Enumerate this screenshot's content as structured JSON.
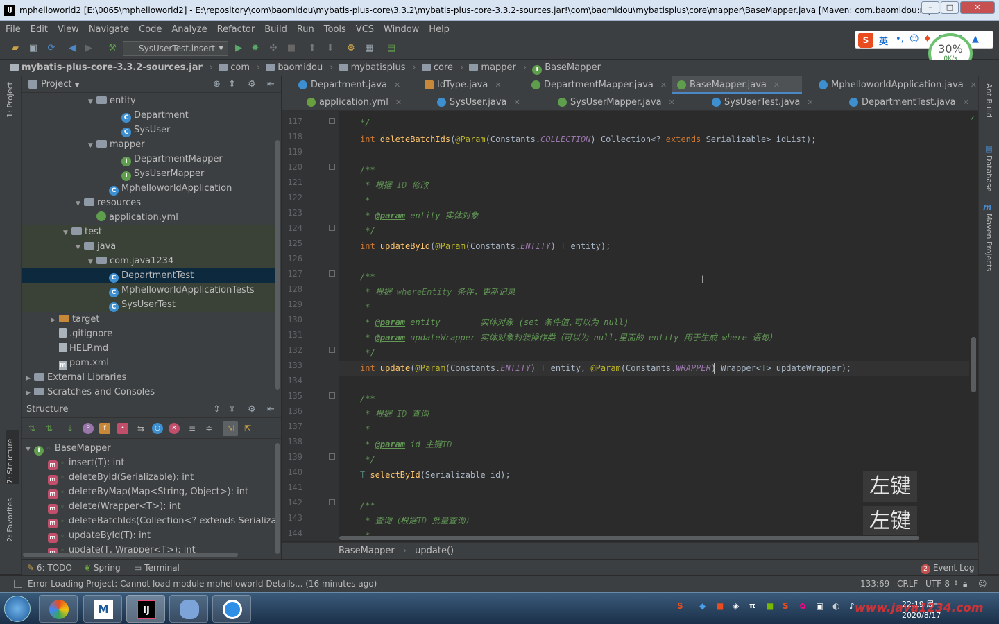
{
  "window": {
    "title": "mphelloworld2 [E:\\0065\\mphelloworld2] - E:\\repository\\com\\baomidou\\mybatis-plus-core\\3.3.2\\mybatis-plus-core-3.3.2-sources.jar!\\com\\baomidou\\mybatisplus\\core\\mapper\\BaseMapper.java [Maven: com.baomidou:myb..."
  },
  "menu": [
    "File",
    "Edit",
    "View",
    "Navigate",
    "Code",
    "Analyze",
    "Refactor",
    "Build",
    "Run",
    "Tools",
    "VCS",
    "Window",
    "Help"
  ],
  "toolbar": {
    "run_config": "SysUserTest.insert"
  },
  "breadcrumb": [
    "mybatis-plus-core-3.3.2-sources.jar",
    "com",
    "baomidou",
    "mybatisplus",
    "core",
    "mapper",
    "BaseMapper"
  ],
  "network": {
    "percent": "30%",
    "speed": "0K/s"
  },
  "ime": {
    "lang": "英"
  },
  "left_strip": {
    "project": "1: Project",
    "structure": "7: Structure",
    "favorites": "2: Favorites"
  },
  "right_strip": {
    "ant": "Ant Build",
    "database": "Database",
    "maven": "Maven Projects"
  },
  "project_panel": {
    "title": "Project",
    "rows": [
      {
        "label": "entity",
        "icon": "folder"
      },
      {
        "label": "Department",
        "icon": "class"
      },
      {
        "label": "SysUser",
        "icon": "class"
      },
      {
        "label": "mapper",
        "icon": "folder"
      },
      {
        "label": "DepartmentMapper",
        "icon": "interface"
      },
      {
        "label": "SysUserMapper",
        "icon": "interface"
      },
      {
        "label": "MphelloworldApplication",
        "icon": "class"
      },
      {
        "label": "resources",
        "icon": "folder"
      },
      {
        "label": "application.yml",
        "icon": "yml"
      },
      {
        "label": "test",
        "icon": "folder"
      },
      {
        "label": "java",
        "icon": "folder"
      },
      {
        "label": "com.java1234",
        "icon": "folder"
      },
      {
        "label": "DepartmentTest",
        "icon": "class"
      },
      {
        "label": "MphelloworldApplicationTests",
        "icon": "class"
      },
      {
        "label": "SysUserTest",
        "icon": "class"
      },
      {
        "label": "target",
        "icon": "folder-yellow"
      },
      {
        "label": ".gitignore",
        "icon": "file"
      },
      {
        "label": "HELP.md",
        "icon": "file"
      },
      {
        "label": "pom.xml",
        "icon": "maven"
      },
      {
        "label": "External Libraries",
        "icon": "library"
      },
      {
        "label": "Scratches and Consoles",
        "icon": "scratch"
      }
    ]
  },
  "structure_panel": {
    "title": "Structure",
    "root": "BaseMapper",
    "items": [
      "insert(T): int",
      "deleteById(Serializable): int",
      "deleteByMap(Map<String, Object>): int",
      "delete(Wrapper<T>): int",
      "deleteBatchIds(Collection<? extends Serializable>):",
      "updateById(T): int",
      "update(T, Wrapper<T>): int"
    ]
  },
  "editor_tabs": {
    "row1": [
      "Department.java",
      "IdType.java",
      "DepartmentMapper.java",
      "BaseMapper.java",
      "MphelloworldApplication.java"
    ],
    "row2": [
      "application.yml",
      "SysUser.java",
      "SysUserMapper.java",
      "SysUserTest.java",
      "DepartmentTest.java"
    ]
  },
  "line_numbers": [
    "117",
    "118",
    "119",
    "120",
    "121",
    "122",
    "123",
    "124",
    "125",
    "126",
    "127",
    "128",
    "129",
    "130",
    "131",
    "132",
    "133",
    "134",
    "135",
    "136",
    "137",
    "138",
    "139",
    "140",
    "141",
    "142",
    "143",
    "144"
  ],
  "code": {
    "l117": "*/",
    "l118": {
      "kw": "int ",
      "fn": "deleteBatchIds",
      "p1": "(",
      "an": "@Param",
      "p2": "(Constants.",
      "cs": "COLLECTION",
      "p3": ") Collection<? ",
      "kw2": "extends",
      "p4": " Serializable> idList);"
    },
    "l120": "/**",
    "l121": {
      "a": "* 根据 ",
      "b": "ID",
      "c": " 修改"
    },
    "l122": "*",
    "l123": {
      "a": "* ",
      "tag": "@param",
      "b": " entity",
      "c": " 实体对象"
    },
    "l124": "*/",
    "l125": {
      "kw": "int ",
      "fn": "updateById",
      "an": "@Param",
      "cs": "ENTITY",
      "gn": "T",
      "rest": " entity);"
    },
    "l127": "/**",
    "l128": {
      "a": "* 根据 ",
      "b": "whereEntity",
      "c": " 条件，更新记录"
    },
    "l129": "*",
    "l130": {
      "a": "* ",
      "tag": "@param",
      "b": " entity",
      "c": "        实体对象 (",
      "d": "set",
      "e": " 条件值,可以为 ",
      "f": "null",
      "g": ")"
    },
    "l131": {
      "a": "* ",
      "tag": "@param",
      "b": " updateWrapper",
      "c": " 实体对象封装操作类（可以为 ",
      "d": "null",
      "e": ",里面的 ",
      "f": "entity",
      "g": " 用于生成 ",
      "h": "where",
      "i": " 语句）"
    },
    "l132": "*/",
    "l133": {
      "kw": "int ",
      "fn": "update",
      "an": "@Param",
      "cs1": "ENTITY",
      "gn": "T",
      "mid": " entity, ",
      "an2": "@Param",
      "cs2": "WRAPPER",
      "rest1": ") Wrapper<",
      "gn2": "T",
      "rest2": "> updateWrapper);"
    },
    "l135": "/**",
    "l136": {
      "a": "* 根据 ",
      "b": "ID",
      "c": " 查询"
    },
    "l137": "*",
    "l138": {
      "a": "* ",
      "tag": "@param",
      "b": " id",
      "c": " 主键",
      "d": "ID"
    },
    "l139": "*/",
    "l140": {
      "gn": "T ",
      "fn": "selectById",
      "rest": "(Serializable id);"
    },
    "l142": "/**",
    "l143": {
      "a": "* 查询（根据",
      "b": "ID",
      "c": " 批量查询）"
    },
    "l144": "*"
  },
  "editor_breadcrumb": [
    "BaseMapper",
    "update()"
  ],
  "bottom_tabs": {
    "todo": "6: TODO",
    "spring": "Spring",
    "terminal": "Terminal",
    "event_log": "Event Log",
    "event_count": "2"
  },
  "status": {
    "message": "Error Loading Project: Cannot load module mphelloworld Details... (16 minutes ago)",
    "position": "133:69",
    "line_sep": "CRLF",
    "encoding": "UTF-8"
  },
  "overlay": [
    "左键",
    "左键"
  ],
  "taskbar": {
    "time": "22:19",
    "time_suffix": "周一",
    "date": "2020/8/17",
    "watermark": "www.java1234.com"
  },
  "colors": {
    "accent": "#4a88c7",
    "keyword": "#cc7832",
    "comment": "#629755",
    "annotation": "#bbb529"
  }
}
